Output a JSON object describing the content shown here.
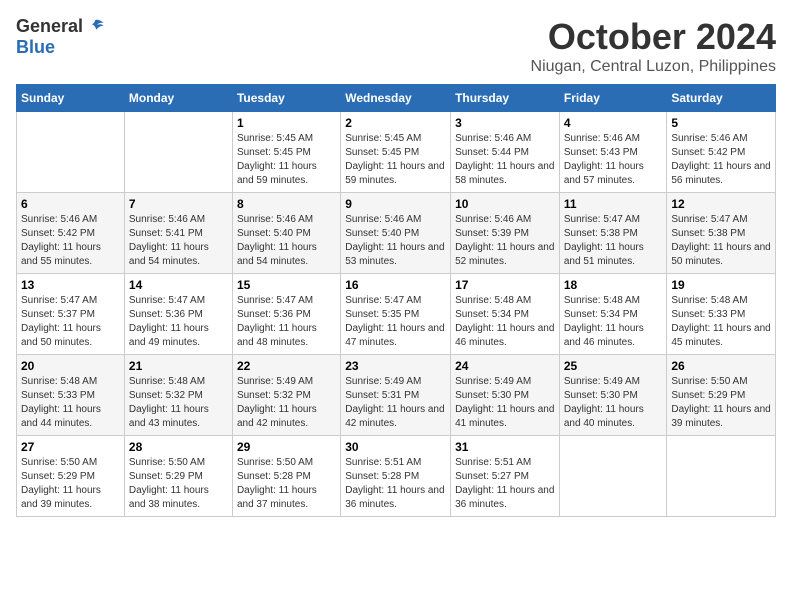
{
  "logo": {
    "general": "General",
    "blue": "Blue"
  },
  "title": "October 2024",
  "location": "Niugan, Central Luzon, Philippines",
  "days_of_week": [
    "Sunday",
    "Monday",
    "Tuesday",
    "Wednesday",
    "Thursday",
    "Friday",
    "Saturday"
  ],
  "weeks": [
    [
      {
        "day": "",
        "sunrise": "",
        "sunset": "",
        "daylight": ""
      },
      {
        "day": "",
        "sunrise": "",
        "sunset": "",
        "daylight": ""
      },
      {
        "day": "1",
        "sunrise": "Sunrise: 5:45 AM",
        "sunset": "Sunset: 5:45 PM",
        "daylight": "Daylight: 11 hours and 59 minutes."
      },
      {
        "day": "2",
        "sunrise": "Sunrise: 5:45 AM",
        "sunset": "Sunset: 5:45 PM",
        "daylight": "Daylight: 11 hours and 59 minutes."
      },
      {
        "day": "3",
        "sunrise": "Sunrise: 5:46 AM",
        "sunset": "Sunset: 5:44 PM",
        "daylight": "Daylight: 11 hours and 58 minutes."
      },
      {
        "day": "4",
        "sunrise": "Sunrise: 5:46 AM",
        "sunset": "Sunset: 5:43 PM",
        "daylight": "Daylight: 11 hours and 57 minutes."
      },
      {
        "day": "5",
        "sunrise": "Sunrise: 5:46 AM",
        "sunset": "Sunset: 5:42 PM",
        "daylight": "Daylight: 11 hours and 56 minutes."
      }
    ],
    [
      {
        "day": "6",
        "sunrise": "Sunrise: 5:46 AM",
        "sunset": "Sunset: 5:42 PM",
        "daylight": "Daylight: 11 hours and 55 minutes."
      },
      {
        "day": "7",
        "sunrise": "Sunrise: 5:46 AM",
        "sunset": "Sunset: 5:41 PM",
        "daylight": "Daylight: 11 hours and 54 minutes."
      },
      {
        "day": "8",
        "sunrise": "Sunrise: 5:46 AM",
        "sunset": "Sunset: 5:40 PM",
        "daylight": "Daylight: 11 hours and 54 minutes."
      },
      {
        "day": "9",
        "sunrise": "Sunrise: 5:46 AM",
        "sunset": "Sunset: 5:40 PM",
        "daylight": "Daylight: 11 hours and 53 minutes."
      },
      {
        "day": "10",
        "sunrise": "Sunrise: 5:46 AM",
        "sunset": "Sunset: 5:39 PM",
        "daylight": "Daylight: 11 hours and 52 minutes."
      },
      {
        "day": "11",
        "sunrise": "Sunrise: 5:47 AM",
        "sunset": "Sunset: 5:38 PM",
        "daylight": "Daylight: 11 hours and 51 minutes."
      },
      {
        "day": "12",
        "sunrise": "Sunrise: 5:47 AM",
        "sunset": "Sunset: 5:38 PM",
        "daylight": "Daylight: 11 hours and 50 minutes."
      }
    ],
    [
      {
        "day": "13",
        "sunrise": "Sunrise: 5:47 AM",
        "sunset": "Sunset: 5:37 PM",
        "daylight": "Daylight: 11 hours and 50 minutes."
      },
      {
        "day": "14",
        "sunrise": "Sunrise: 5:47 AM",
        "sunset": "Sunset: 5:36 PM",
        "daylight": "Daylight: 11 hours and 49 minutes."
      },
      {
        "day": "15",
        "sunrise": "Sunrise: 5:47 AM",
        "sunset": "Sunset: 5:36 PM",
        "daylight": "Daylight: 11 hours and 48 minutes."
      },
      {
        "day": "16",
        "sunrise": "Sunrise: 5:47 AM",
        "sunset": "Sunset: 5:35 PM",
        "daylight": "Daylight: 11 hours and 47 minutes."
      },
      {
        "day": "17",
        "sunrise": "Sunrise: 5:48 AM",
        "sunset": "Sunset: 5:34 PM",
        "daylight": "Daylight: 11 hours and 46 minutes."
      },
      {
        "day": "18",
        "sunrise": "Sunrise: 5:48 AM",
        "sunset": "Sunset: 5:34 PM",
        "daylight": "Daylight: 11 hours and 46 minutes."
      },
      {
        "day": "19",
        "sunrise": "Sunrise: 5:48 AM",
        "sunset": "Sunset: 5:33 PM",
        "daylight": "Daylight: 11 hours and 45 minutes."
      }
    ],
    [
      {
        "day": "20",
        "sunrise": "Sunrise: 5:48 AM",
        "sunset": "Sunset: 5:33 PM",
        "daylight": "Daylight: 11 hours and 44 minutes."
      },
      {
        "day": "21",
        "sunrise": "Sunrise: 5:48 AM",
        "sunset": "Sunset: 5:32 PM",
        "daylight": "Daylight: 11 hours and 43 minutes."
      },
      {
        "day": "22",
        "sunrise": "Sunrise: 5:49 AM",
        "sunset": "Sunset: 5:32 PM",
        "daylight": "Daylight: 11 hours and 42 minutes."
      },
      {
        "day": "23",
        "sunrise": "Sunrise: 5:49 AM",
        "sunset": "Sunset: 5:31 PM",
        "daylight": "Daylight: 11 hours and 42 minutes."
      },
      {
        "day": "24",
        "sunrise": "Sunrise: 5:49 AM",
        "sunset": "Sunset: 5:30 PM",
        "daylight": "Daylight: 11 hours and 41 minutes."
      },
      {
        "day": "25",
        "sunrise": "Sunrise: 5:49 AM",
        "sunset": "Sunset: 5:30 PM",
        "daylight": "Daylight: 11 hours and 40 minutes."
      },
      {
        "day": "26",
        "sunrise": "Sunrise: 5:50 AM",
        "sunset": "Sunset: 5:29 PM",
        "daylight": "Daylight: 11 hours and 39 minutes."
      }
    ],
    [
      {
        "day": "27",
        "sunrise": "Sunrise: 5:50 AM",
        "sunset": "Sunset: 5:29 PM",
        "daylight": "Daylight: 11 hours and 39 minutes."
      },
      {
        "day": "28",
        "sunrise": "Sunrise: 5:50 AM",
        "sunset": "Sunset: 5:29 PM",
        "daylight": "Daylight: 11 hours and 38 minutes."
      },
      {
        "day": "29",
        "sunrise": "Sunrise: 5:50 AM",
        "sunset": "Sunset: 5:28 PM",
        "daylight": "Daylight: 11 hours and 37 minutes."
      },
      {
        "day": "30",
        "sunrise": "Sunrise: 5:51 AM",
        "sunset": "Sunset: 5:28 PM",
        "daylight": "Daylight: 11 hours and 36 minutes."
      },
      {
        "day": "31",
        "sunrise": "Sunrise: 5:51 AM",
        "sunset": "Sunset: 5:27 PM",
        "daylight": "Daylight: 11 hours and 36 minutes."
      },
      {
        "day": "",
        "sunrise": "",
        "sunset": "",
        "daylight": ""
      },
      {
        "day": "",
        "sunrise": "",
        "sunset": "",
        "daylight": ""
      }
    ]
  ]
}
